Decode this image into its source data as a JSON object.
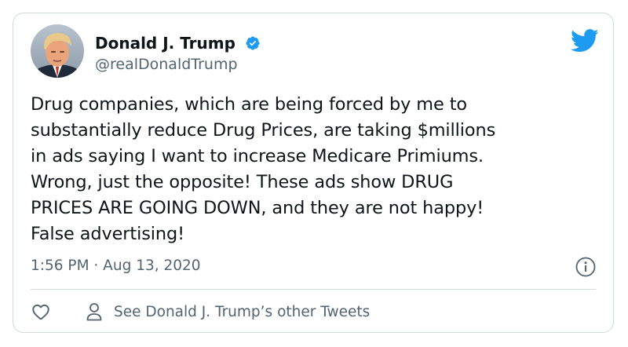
{
  "tweet": {
    "author_name": "Donald J. Trump",
    "author_handle": "@realDonaldTrump",
    "text": "Drug companies, which are being forced by me to\nsubstantially reduce Drug Prices, are taking $millions\nin ads saying I want to increase Medicare Primiums.\nWrong, just the opposite! These ads show DRUG\nPRICES ARE GOING DOWN, and they are not happy!\nFalse advertising!",
    "timestamp": "1:56 PM · Aug 13, 2020",
    "other_tweets_label": "See Donald J. Trump’s other Tweets"
  },
  "icons": {
    "verified": "verified-badge-icon",
    "brand": "twitter-bird-icon",
    "info": "info-icon",
    "like": "heart-icon",
    "profile": "person-icon"
  },
  "colors": {
    "brand_blue": "#1d9bf0",
    "text_primary": "#0f1419",
    "text_secondary": "#536471",
    "border": "#cfd9de"
  }
}
